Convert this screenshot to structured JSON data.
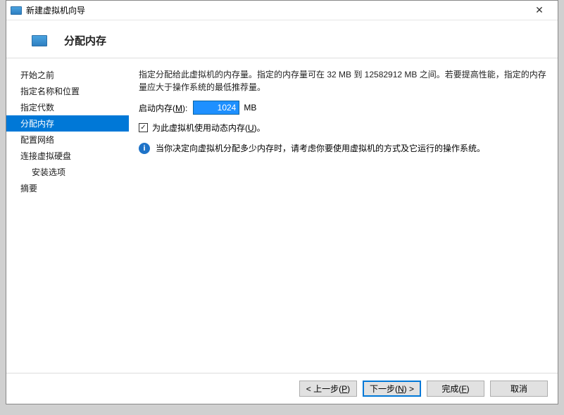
{
  "window": {
    "title": "新建虚拟机向导",
    "close_label": "✕"
  },
  "header": {
    "page_title": "分配内存"
  },
  "sidebar": {
    "items": [
      {
        "label": "开始之前",
        "selected": false,
        "indent": false
      },
      {
        "label": "指定名称和位置",
        "selected": false,
        "indent": false
      },
      {
        "label": "指定代数",
        "selected": false,
        "indent": false
      },
      {
        "label": "分配内存",
        "selected": true,
        "indent": false
      },
      {
        "label": "配置网络",
        "selected": false,
        "indent": false
      },
      {
        "label": "连接虚拟硬盘",
        "selected": false,
        "indent": false
      },
      {
        "label": "安装选项",
        "selected": false,
        "indent": true
      },
      {
        "label": "摘要",
        "selected": false,
        "indent": false
      }
    ]
  },
  "main": {
    "description": "指定分配给此虚拟机的内存量。指定的内存量可在 32 MB 到 12582912 MB 之间。若要提高性能，指定的内存量应大于操作系统的最低推荐量。",
    "memory_label_pre": "启动内存(",
    "memory_accel": "M",
    "memory_label_post": "):",
    "memory_value": "1024",
    "memory_unit": "MB",
    "dynamic_checked": true,
    "dynamic_label_pre": "为此虚拟机使用动态内存(",
    "dynamic_accel": "U",
    "dynamic_label_post": ")。",
    "info_text": "当你决定向虚拟机分配多少内存时，请考虑你要使用虚拟机的方式及它运行的操作系统。"
  },
  "footer": {
    "prev_pre": "< 上一步(",
    "prev_accel": "P",
    "prev_post": ")",
    "next_pre": "下一步(",
    "next_accel": "N",
    "next_post": ") >",
    "finish_pre": "完成(",
    "finish_accel": "F",
    "finish_post": ")",
    "cancel": "取消"
  }
}
